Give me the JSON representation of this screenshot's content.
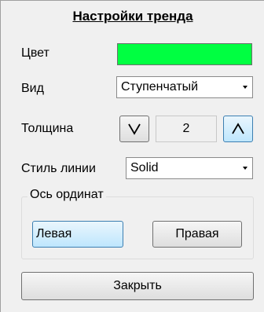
{
  "title": "Настройки тренда",
  "color_row": {
    "label": "Цвет",
    "swatch_color": "#00ff41"
  },
  "type_row": {
    "label": "Вид",
    "selected": "Ступенчатый"
  },
  "thickness_row": {
    "label": "Толщина",
    "value": "2",
    "down_icon": "chevron-down",
    "up_icon": "chevron-up"
  },
  "line_style_row": {
    "label": "Стиль линии",
    "selected": "Solid"
  },
  "y_axis_group": {
    "label": "Ось ординат",
    "left_label": "Левая",
    "right_label": "Правая"
  },
  "close_label": "Закрыть"
}
